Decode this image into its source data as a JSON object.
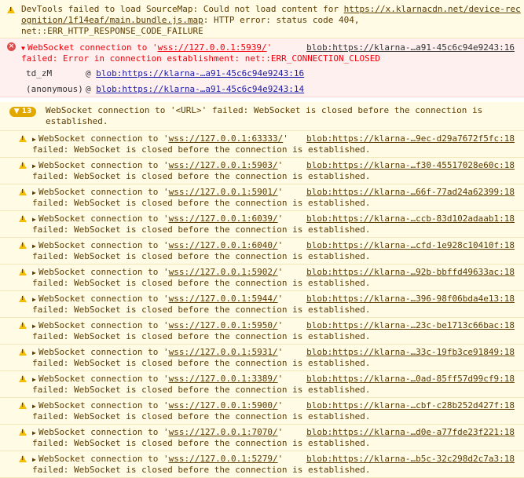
{
  "sourcemap_warning": {
    "line1": "DevTools failed to load SourceMap: Could not load content for ",
    "url_part1": "https://x.klarnacdn.net/device-rec",
    "url_part2": "ognition/1f14eaf/main.bundle.js.map",
    "line2_rest": ": HTTP error: status code 404,",
    "line3": "net::ERR_HTTP_RESPONSE_CODE_FAILURE"
  },
  "ws_error": {
    "prefix": "WebSocket connection to '",
    "url": "wss://127.0.0.1:5939/",
    "suffix": "'",
    "source": "blob:https://klarna-…a91-45c6c94e9243:16",
    "line2": "failed: Error in connection establishment: net::ERR_CONNECTION_CLOSED",
    "stack": [
      {
        "fn": "td_zM",
        "at": "@ ",
        "link": "blob:https://klarna-…a91-45c6c94e9243:16"
      },
      {
        "fn": "(anonymous)",
        "at": "@ ",
        "link": "blob:https://klarna-…a91-45c6c94e9243:14"
      }
    ]
  },
  "group": {
    "badge": "▼ 13",
    "line1": "WebSocket connection to '<URL>' failed: WebSocket is closed before the connection is",
    "line2": "established."
  },
  "ws_warnings": {
    "prefix": "WebSocket connection to '",
    "suffix": "'",
    "line2": "failed: WebSocket is closed before the connection is established.",
    "items": [
      {
        "url": "wss://127.0.0.1:63333/",
        "source": "blob:https://klarna-…9ec-d29a7672f5fc:18"
      },
      {
        "url": "wss://127.0.0.1:5903/",
        "source": "blob:https://klarna-…f30-45517028e60c:18"
      },
      {
        "url": "wss://127.0.0.1:5901/",
        "source": "blob:https://klarna-…66f-77ad24a62399:18"
      },
      {
        "url": "wss://127.0.0.1:6039/",
        "source": "blob:https://klarna-…ccb-83d102adaab1:18"
      },
      {
        "url": "wss://127.0.0.1:6040/",
        "source": "blob:https://klarna-…cfd-1e928c10410f:18"
      },
      {
        "url": "wss://127.0.0.1:5902/",
        "source": "blob:https://klarna-…92b-bbffd49633ac:18"
      },
      {
        "url": "wss://127.0.0.1:5944/",
        "source": "blob:https://klarna-…396-98f06bda4e13:18"
      },
      {
        "url": "wss://127.0.0.1:5950/",
        "source": "blob:https://klarna-…23c-be1713c66bac:18"
      },
      {
        "url": "wss://127.0.0.1:5931/",
        "source": "blob:https://klarna-…33c-19fb3ce91849:18"
      },
      {
        "url": "wss://127.0.0.1:3389/",
        "source": "blob:https://klarna-…0ad-85ff57d99cf9:18"
      },
      {
        "url": "wss://127.0.0.1:5900/",
        "source": "blob:https://klarna-…cbf-c28b252d427f:18"
      },
      {
        "url": "wss://127.0.0.1:7070/",
        "source": "blob:https://klarna-…d0e-a77fde23f221:18"
      },
      {
        "url": "wss://127.0.0.1:5279/",
        "source": "blob:https://klarna-…b5c-32c298d2c7a3:18"
      }
    ]
  },
  "colors": {
    "warning_bg": "#fffbe5",
    "error_bg": "#fff0f0",
    "warning_icon": "#f4bd00",
    "error_icon": "#e24b4b"
  }
}
